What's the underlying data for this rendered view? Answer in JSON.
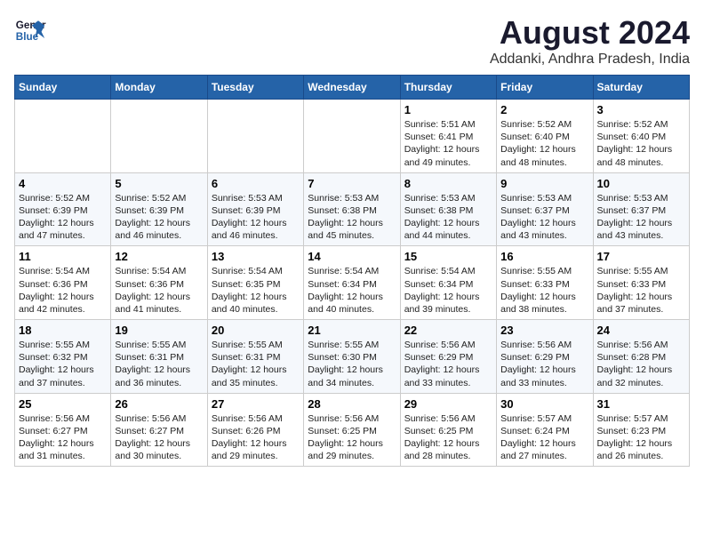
{
  "logo": {
    "line1": "General",
    "line2": "Blue"
  },
  "title": "August 2024",
  "subtitle": "Addanki, Andhra Pradesh, India",
  "days_of_week": [
    "Sunday",
    "Monday",
    "Tuesday",
    "Wednesday",
    "Thursday",
    "Friday",
    "Saturday"
  ],
  "weeks": [
    {
      "cells": [
        {
          "day": "",
          "content": ""
        },
        {
          "day": "",
          "content": ""
        },
        {
          "day": "",
          "content": ""
        },
        {
          "day": "",
          "content": ""
        },
        {
          "day": "1",
          "content": "Sunrise: 5:51 AM\nSunset: 6:41 PM\nDaylight: 12 hours\nand 49 minutes."
        },
        {
          "day": "2",
          "content": "Sunrise: 5:52 AM\nSunset: 6:40 PM\nDaylight: 12 hours\nand 48 minutes."
        },
        {
          "day": "3",
          "content": "Sunrise: 5:52 AM\nSunset: 6:40 PM\nDaylight: 12 hours\nand 48 minutes."
        }
      ]
    },
    {
      "cells": [
        {
          "day": "4",
          "content": "Sunrise: 5:52 AM\nSunset: 6:39 PM\nDaylight: 12 hours\nand 47 minutes."
        },
        {
          "day": "5",
          "content": "Sunrise: 5:52 AM\nSunset: 6:39 PM\nDaylight: 12 hours\nand 46 minutes."
        },
        {
          "day": "6",
          "content": "Sunrise: 5:53 AM\nSunset: 6:39 PM\nDaylight: 12 hours\nand 46 minutes."
        },
        {
          "day": "7",
          "content": "Sunrise: 5:53 AM\nSunset: 6:38 PM\nDaylight: 12 hours\nand 45 minutes."
        },
        {
          "day": "8",
          "content": "Sunrise: 5:53 AM\nSunset: 6:38 PM\nDaylight: 12 hours\nand 44 minutes."
        },
        {
          "day": "9",
          "content": "Sunrise: 5:53 AM\nSunset: 6:37 PM\nDaylight: 12 hours\nand 43 minutes."
        },
        {
          "day": "10",
          "content": "Sunrise: 5:53 AM\nSunset: 6:37 PM\nDaylight: 12 hours\nand 43 minutes."
        }
      ]
    },
    {
      "cells": [
        {
          "day": "11",
          "content": "Sunrise: 5:54 AM\nSunset: 6:36 PM\nDaylight: 12 hours\nand 42 minutes."
        },
        {
          "day": "12",
          "content": "Sunrise: 5:54 AM\nSunset: 6:36 PM\nDaylight: 12 hours\nand 41 minutes."
        },
        {
          "day": "13",
          "content": "Sunrise: 5:54 AM\nSunset: 6:35 PM\nDaylight: 12 hours\nand 40 minutes."
        },
        {
          "day": "14",
          "content": "Sunrise: 5:54 AM\nSunset: 6:34 PM\nDaylight: 12 hours\nand 40 minutes."
        },
        {
          "day": "15",
          "content": "Sunrise: 5:54 AM\nSunset: 6:34 PM\nDaylight: 12 hours\nand 39 minutes."
        },
        {
          "day": "16",
          "content": "Sunrise: 5:55 AM\nSunset: 6:33 PM\nDaylight: 12 hours\nand 38 minutes."
        },
        {
          "day": "17",
          "content": "Sunrise: 5:55 AM\nSunset: 6:33 PM\nDaylight: 12 hours\nand 37 minutes."
        }
      ]
    },
    {
      "cells": [
        {
          "day": "18",
          "content": "Sunrise: 5:55 AM\nSunset: 6:32 PM\nDaylight: 12 hours\nand 37 minutes."
        },
        {
          "day": "19",
          "content": "Sunrise: 5:55 AM\nSunset: 6:31 PM\nDaylight: 12 hours\nand 36 minutes."
        },
        {
          "day": "20",
          "content": "Sunrise: 5:55 AM\nSunset: 6:31 PM\nDaylight: 12 hours\nand 35 minutes."
        },
        {
          "day": "21",
          "content": "Sunrise: 5:55 AM\nSunset: 6:30 PM\nDaylight: 12 hours\nand 34 minutes."
        },
        {
          "day": "22",
          "content": "Sunrise: 5:56 AM\nSunset: 6:29 PM\nDaylight: 12 hours\nand 33 minutes."
        },
        {
          "day": "23",
          "content": "Sunrise: 5:56 AM\nSunset: 6:29 PM\nDaylight: 12 hours\nand 33 minutes."
        },
        {
          "day": "24",
          "content": "Sunrise: 5:56 AM\nSunset: 6:28 PM\nDaylight: 12 hours\nand 32 minutes."
        }
      ]
    },
    {
      "cells": [
        {
          "day": "25",
          "content": "Sunrise: 5:56 AM\nSunset: 6:27 PM\nDaylight: 12 hours\nand 31 minutes."
        },
        {
          "day": "26",
          "content": "Sunrise: 5:56 AM\nSunset: 6:27 PM\nDaylight: 12 hours\nand 30 minutes."
        },
        {
          "day": "27",
          "content": "Sunrise: 5:56 AM\nSunset: 6:26 PM\nDaylight: 12 hours\nand 29 minutes."
        },
        {
          "day": "28",
          "content": "Sunrise: 5:56 AM\nSunset: 6:25 PM\nDaylight: 12 hours\nand 29 minutes."
        },
        {
          "day": "29",
          "content": "Sunrise: 5:56 AM\nSunset: 6:25 PM\nDaylight: 12 hours\nand 28 minutes."
        },
        {
          "day": "30",
          "content": "Sunrise: 5:57 AM\nSunset: 6:24 PM\nDaylight: 12 hours\nand 27 minutes."
        },
        {
          "day": "31",
          "content": "Sunrise: 5:57 AM\nSunset: 6:23 PM\nDaylight: 12 hours\nand 26 minutes."
        }
      ]
    }
  ]
}
